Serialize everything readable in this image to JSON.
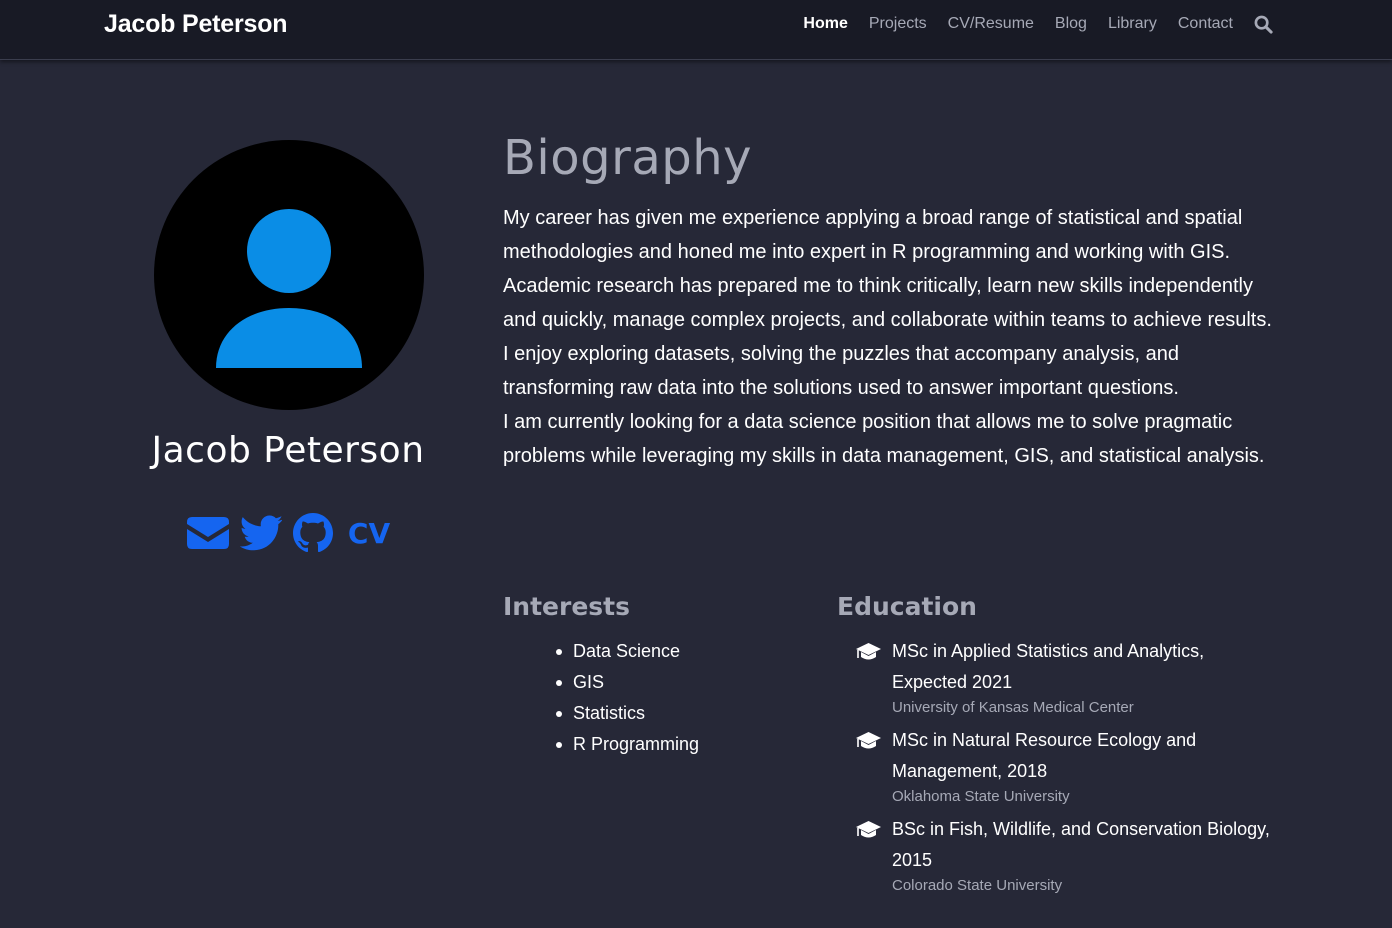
{
  "navbar": {
    "brand": "Jacob Peterson",
    "links": [
      {
        "label": "Home",
        "active": true
      },
      {
        "label": "Projects"
      },
      {
        "label": "CV/Resume"
      },
      {
        "label": "Blog"
      },
      {
        "label": "Library"
      },
      {
        "label": "Contact"
      }
    ],
    "search_icon": "search-icon"
  },
  "profile": {
    "name": "Jacob Peterson",
    "avatar_icon": "user-avatar-icon",
    "avatar_colors": {
      "background": "#000000",
      "figure": "#0a8de6"
    },
    "social": [
      {
        "icon": "envelope-icon"
      },
      {
        "icon": "twitter-icon"
      },
      {
        "icon": "github-icon"
      },
      {
        "label": "CV"
      }
    ],
    "social_color": "#1565f0"
  },
  "biography": {
    "title": "Biography",
    "paragraphs": [
      "My career has given me experience applying a broad range of statistical and spatial methodologies and honed me into expert in R programming and working with GIS. Academic research has prepared me to think critically, learn new skills independently and quickly, manage complex projects, and collaborate within teams to achieve results. I enjoy exploring datasets, solving the puzzles that accompany analysis, and transforming raw data into the solutions used to answer important questions.",
      "I am currently looking for a data science position that allows me to solve pragmatic problems while leveraging my skills in data management, GIS, and statistical analysis."
    ]
  },
  "interests": {
    "title": "Interests",
    "items": [
      "Data Science",
      "GIS",
      "Statistics",
      "R Programming"
    ]
  },
  "education": {
    "title": "Education",
    "icon": "graduation-cap-icon",
    "items": [
      {
        "course": "MSc in Applied Statistics and Analytics, Expected 2021",
        "institution": "University of Kansas Medical Center"
      },
      {
        "course": "MSc in Natural Resource Ecology and Management, 2018",
        "institution": "Oklahoma State University"
      },
      {
        "course": "BSc in Fish, Wildlife, and Conservation Biology, 2015",
        "institution": "Colorado State University"
      }
    ]
  },
  "colors": {
    "page_bg": "#262837",
    "navbar_bg": "#181a25",
    "muted_text": "#a6a9b6",
    "accent": "#1565f0"
  }
}
